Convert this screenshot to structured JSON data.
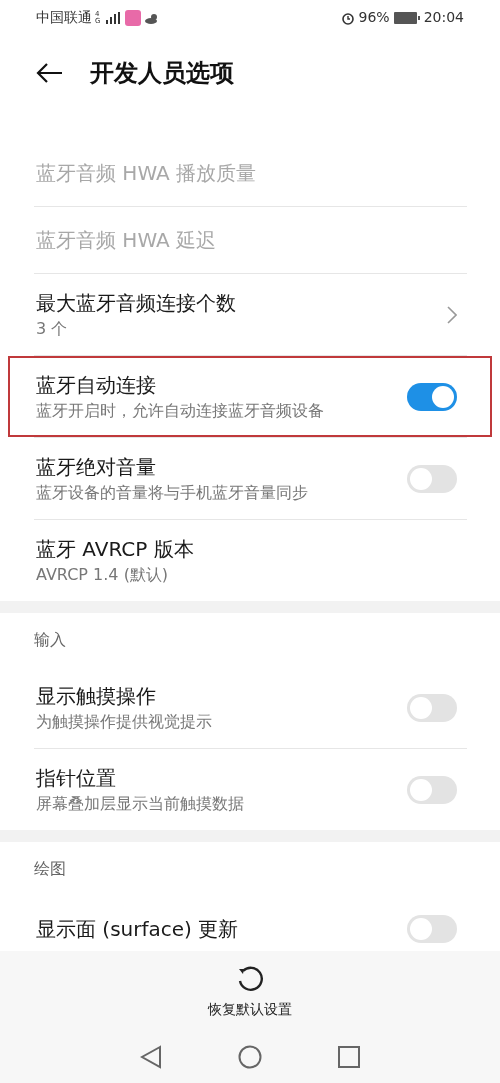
{
  "status_bar": {
    "carrier": "中国联通",
    "network": "4G",
    "battery": "96%",
    "time": "20:04"
  },
  "header": {
    "title": "开发人员选项"
  },
  "sections": [
    {
      "items": [
        {
          "kind": "plain",
          "title": "蓝牙音频 HWA 播放质量",
          "disabled": true
        },
        {
          "kind": "plain",
          "title": "蓝牙音频 HWA 延迟",
          "disabled": true
        },
        {
          "kind": "chevron",
          "title": "最大蓝牙音频连接个数",
          "subtitle": "3 个",
          "disabled": false
        },
        {
          "kind": "switch",
          "title": "蓝牙自动连接",
          "subtitle": "蓝牙开启时，允许自动连接蓝牙音频设备",
          "on": true,
          "highlighted": true,
          "disabled": false
        },
        {
          "kind": "switch",
          "title": "蓝牙绝对音量",
          "subtitle": "蓝牙设备的音量将与手机蓝牙音量同步",
          "on": false,
          "disabled": false
        },
        {
          "kind": "plain",
          "title": "蓝牙 AVRCP 版本",
          "subtitle": "AVRCP 1.4 (默认)",
          "disabled": false
        }
      ]
    },
    {
      "header": "输入",
      "items": [
        {
          "kind": "switch",
          "title": "显示触摸操作",
          "subtitle": "为触摸操作提供视觉提示",
          "on": false,
          "disabled": false
        },
        {
          "kind": "switch",
          "title": "指针位置",
          "subtitle": "屏幕叠加层显示当前触摸数据",
          "on": false,
          "disabled": false
        }
      ]
    },
    {
      "header": "绘图",
      "items": [
        {
          "kind": "switch",
          "title": "显示面 (surface) 更新",
          "on": false,
          "disabled": false
        }
      ]
    }
  ],
  "reset_button": {
    "label": "恢复默认设置"
  }
}
